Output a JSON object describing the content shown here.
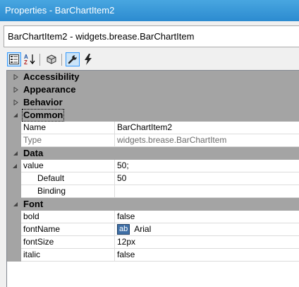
{
  "window": {
    "title": "Properties - BarChartItem2"
  },
  "selector": {
    "value": "BarChartItem2 - widgets.brease.BarChartItem"
  },
  "toolbar": {
    "buttons": [
      {
        "name": "categorized-view-button",
        "icon": "categorized-icon",
        "active": true
      },
      {
        "name": "alphabetical-view-button",
        "icon": "sort-az-icon",
        "active": false
      },
      {
        "name": "object-button",
        "icon": "cube-icon",
        "active": false
      },
      {
        "name": "properties-view-button",
        "icon": "wrench-icon",
        "active": true
      },
      {
        "name": "events-view-button",
        "icon": "lightning-icon",
        "active": false
      }
    ]
  },
  "colors": {
    "titlebar": "#2c8bd0",
    "category": "#a4a4a4",
    "accent": "#3399ff"
  },
  "grid": {
    "categories": {
      "accessibility": {
        "label": "Accessibility",
        "expanded": false
      },
      "appearance": {
        "label": "Appearance",
        "expanded": false
      },
      "behavior": {
        "label": "Behavior",
        "expanded": false
      },
      "common": {
        "label": "Common",
        "expanded": true,
        "props": [
          {
            "name": "Name",
            "value": "BarChartItem2"
          },
          {
            "name": "Type",
            "value": "widgets.brease.BarChartItem",
            "readonly": true
          }
        ]
      },
      "data": {
        "label": "Data",
        "expanded": true,
        "props": [
          {
            "name": "value",
            "value": "50;"
          },
          {
            "name": "Default",
            "value": "50"
          },
          {
            "name": "Binding",
            "value": ""
          }
        ]
      },
      "font": {
        "label": "Font",
        "expanded": true,
        "props": [
          {
            "name": "bold",
            "value": "false"
          },
          {
            "name": "fontName",
            "value": "Arial",
            "badge": "ab"
          },
          {
            "name": "fontSize",
            "value": "12px"
          },
          {
            "name": "italic",
            "value": "false"
          }
        ]
      }
    }
  }
}
